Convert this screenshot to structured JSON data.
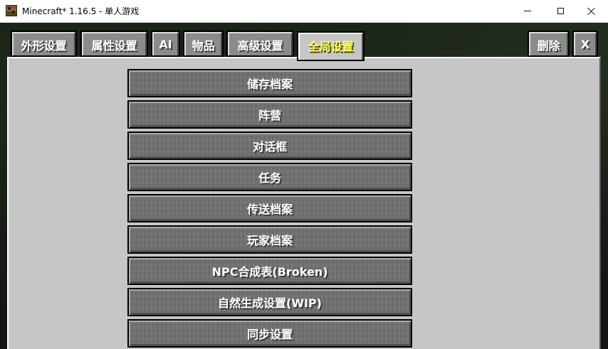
{
  "window": {
    "title": "Minecraft* 1.16.5 - 单人游戏",
    "icon": "minecraft-grass-block-icon"
  },
  "tabs": [
    {
      "label": "外形设置",
      "active": false
    },
    {
      "label": "属性设置",
      "active": false
    },
    {
      "label": "AI",
      "active": false
    },
    {
      "label": "物品",
      "active": false
    },
    {
      "label": "高级设置",
      "active": false
    },
    {
      "label": "全局设置",
      "active": true
    }
  ],
  "right_tabs": {
    "delete_label": "删除",
    "close_label": "X"
  },
  "buttons": [
    {
      "label": "储存档案"
    },
    {
      "label": "阵营"
    },
    {
      "label": "对话框"
    },
    {
      "label": "任务"
    },
    {
      "label": "传送档案"
    },
    {
      "label": "玩家档案"
    },
    {
      "label": "NPC合成表(Broken)"
    },
    {
      "label": "自然生成设置(WIP)"
    },
    {
      "label": "同步设置"
    }
  ],
  "colors": {
    "active_tab_text": "#ffff55",
    "panel_bg": "#c6c6c6",
    "button_bg": "#707070"
  }
}
